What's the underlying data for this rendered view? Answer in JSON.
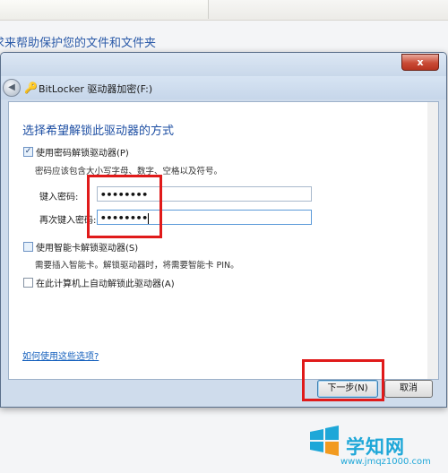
{
  "background": {
    "heading": "求来帮助保护您的文件和文件夹"
  },
  "window": {
    "close_glyph": "x",
    "back_glyph": "◀",
    "title": "BitLocker 驱动器加密(F:)"
  },
  "dialog": {
    "heading": "选择希望解锁此驱动器的方式",
    "option_password": {
      "label": "使用密码解锁驱动器(P)",
      "checked": true
    },
    "password_hint": "密码应该包含大小写字母、数字、空格以及符号。",
    "enter_password_label": "键入密码:",
    "enter_password_value": "••••••••",
    "reenter_password_label": "再次键入密码:",
    "reenter_password_value": "••••••••",
    "option_smartcard": {
      "label": "使用智能卡解锁驱动器(S)",
      "checked": false
    },
    "smartcard_hint": "需要插入智能卡。解锁驱动器时，将需要智能卡 PIN。",
    "option_autounlock": {
      "label": "在此计算机上自动解锁此驱动器(A)",
      "checked": false
    },
    "help_link": "如何使用这些选项?",
    "next_button": "下一步(N)",
    "cancel_button": "取消"
  },
  "watermark": {
    "name": "学知网",
    "url": "www.jmqz1000.com"
  },
  "colors": {
    "annotation": "#e01a1a",
    "heading": "#1e4fa3",
    "link": "#1560bd"
  }
}
